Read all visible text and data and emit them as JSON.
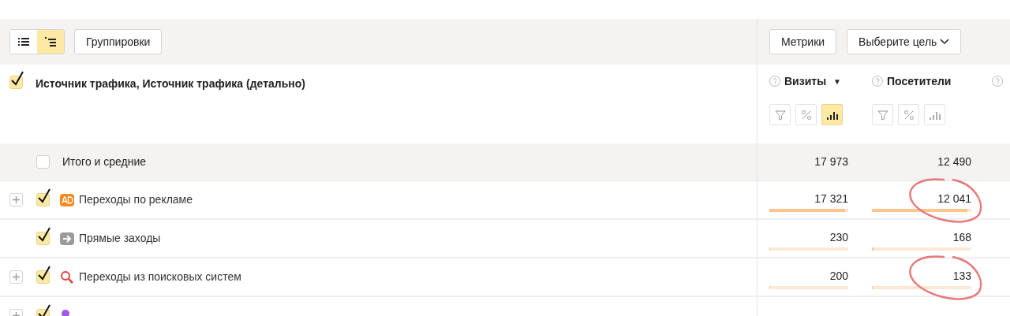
{
  "toolbar": {
    "view_toggles": [
      {
        "kind": "list",
        "selected": false
      },
      {
        "kind": "tree",
        "selected": true
      }
    ],
    "groupings_button": "Группировки",
    "metrics_button": "Метрики",
    "goal_dropdown": "Выберите цель"
  },
  "dimension_header": {
    "label": "Источник трафика, Источник трафика (детально)",
    "checked": true
  },
  "columns": [
    {
      "label": "Визиты",
      "sort_mark": "▼",
      "tools": [
        {
          "kind": "filter",
          "selected": false
        },
        {
          "kind": "percent",
          "selected": false
        },
        {
          "kind": "bars",
          "selected": true
        }
      ]
    },
    {
      "label": "Посетители",
      "tools": [
        {
          "kind": "filter",
          "selected": false
        },
        {
          "kind": "percent",
          "selected": false
        },
        {
          "kind": "bars",
          "selected": false
        }
      ]
    },
    {}
  ],
  "totals": {
    "label": "Итого и средние",
    "checked": false,
    "values": [
      "17 973",
      "12 490"
    ]
  },
  "rows": [
    {
      "label": "Переходы по рекламе",
      "kind": "ad",
      "expandable": true,
      "checked": true,
      "cells": [
        {
          "value": "17 321",
          "level": 0.96,
          "circled": false
        },
        {
          "value": "12 041",
          "level": 0.96,
          "circled": true
        }
      ]
    },
    {
      "label": "Прямые заходы",
      "kind": "direct",
      "expandable": false,
      "checked": true,
      "cells": [
        {
          "value": "230",
          "level": 0.013,
          "circled": false
        },
        {
          "value": "168",
          "level": 0.013,
          "circled": false
        }
      ]
    },
    {
      "label": "Переходы из поисковых систем",
      "kind": "search",
      "expandable": true,
      "checked": true,
      "cells": [
        {
          "value": "200",
          "level": 0.011,
          "circled": false
        },
        {
          "value": "133",
          "level": 0.011,
          "circled": true
        }
      ]
    },
    {
      "kind": "social",
      "expandable": true,
      "checked": true
    }
  ]
}
